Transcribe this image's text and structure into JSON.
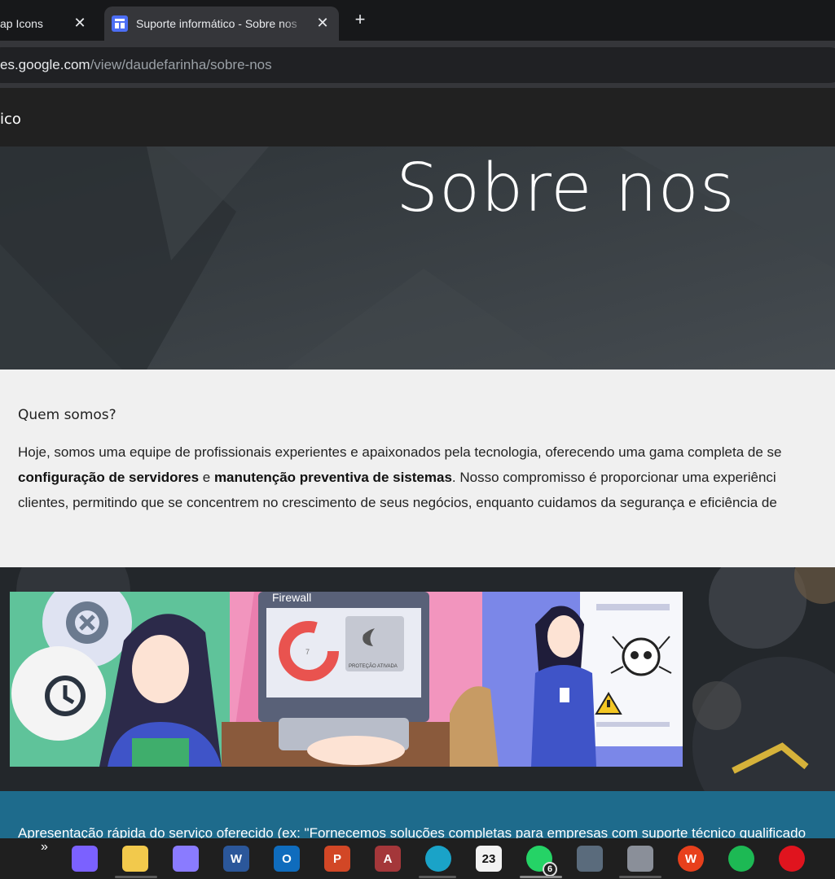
{
  "browser": {
    "tabs": [
      {
        "title": "ap Icons",
        "active": false
      },
      {
        "title": "Suporte informático - Sobre nos",
        "active": true
      }
    ],
    "close_glyph": "✕",
    "new_tab_glyph": "+",
    "url": {
      "host": "es.google.com",
      "path": "/view/daudefarinha/sobre-nos"
    }
  },
  "site": {
    "name": "ico",
    "hero_title": "Sobre nos",
    "about": {
      "heading": "Quem somos?",
      "line1": "Hoje, somos uma equipe de profissionais experientes e apaixonados pela tecnologia, oferecendo uma gama completa de se",
      "line2_bold1": "configuração de servidores",
      "line2_mid": " e ",
      "line2_bold2": "manutenção preventiva de sistemas",
      "line2_rest": ". Nosso compromisso é proporcionar uma experiênci",
      "line3": "clientes, permitindo que se concentrem no crescimento de seus negócios, enquanto cuidamos da segurança e eficiência de"
    },
    "banner": {
      "firewall_label": "Firewall",
      "protection_label": "PROTEÇÃO ATIVADA",
      "donut_value": "7"
    },
    "service_text": "Apresentação rápida do serviço oferecido (ex: \"Fornecemos soluções completas para empresas com suporte técnico qualificado"
  },
  "taskbar": {
    "overflow_glyph": "»",
    "items": [
      {
        "name": "copilot-icon",
        "label": "",
        "color": "#7b61ff"
      },
      {
        "name": "file-explorer-icon",
        "label": "",
        "color": "#f2c94c"
      },
      {
        "name": "game-controller-icon",
        "label": "",
        "color": "#8a7bff"
      },
      {
        "name": "word-icon",
        "label": "W",
        "color": "#2b579a"
      },
      {
        "name": "outlook-icon",
        "label": "O",
        "color": "#0f6cbd"
      },
      {
        "name": "powerpoint-icon",
        "label": "P",
        "color": "#d24726"
      },
      {
        "name": "access-icon",
        "label": "A",
        "color": "#a4373a"
      },
      {
        "name": "edge-icon",
        "label": "",
        "color": "#1aa3c8"
      },
      {
        "name": "calendar-23-icon",
        "label": "23",
        "color": "#f2f2f2"
      },
      {
        "name": "whatsapp-icon",
        "label": "",
        "color": "#25d366",
        "badge": "6"
      },
      {
        "name": "photo-thumbnail-icon",
        "label": "",
        "color": "#5a6b7c"
      },
      {
        "name": "photo-thumbnail-2-icon",
        "label": "",
        "color": "#8a8f99"
      },
      {
        "name": "wps-office-icon",
        "label": "W",
        "color": "#e8401c"
      },
      {
        "name": "spotify-icon",
        "label": "",
        "color": "#1db954"
      },
      {
        "name": "opera-icon",
        "label": "",
        "color": "#e0141e"
      }
    ]
  }
}
